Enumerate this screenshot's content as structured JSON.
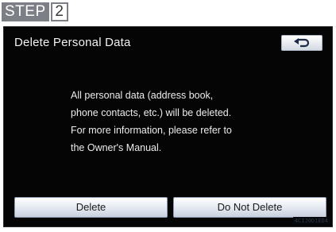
{
  "step": {
    "word": "STEP",
    "number": "2"
  },
  "screen": {
    "title": "Delete Personal Data",
    "back_icon": "return-arrow-icon",
    "message_lines": [
      "All personal data (address book,",
      "phone contacts, etc.) will be deleted.",
      "For more information, please refer to",
      "the Owner's Manual."
    ],
    "buttons": {
      "delete_label": "Delete",
      "do_not_delete_label": "Do Not Delete"
    },
    "corner_code": "4CIJ0D1ED4"
  },
  "colors": {
    "screen_background": "#050505",
    "button_face": "#e3e8f0",
    "step_badge": "#7c7f86"
  }
}
